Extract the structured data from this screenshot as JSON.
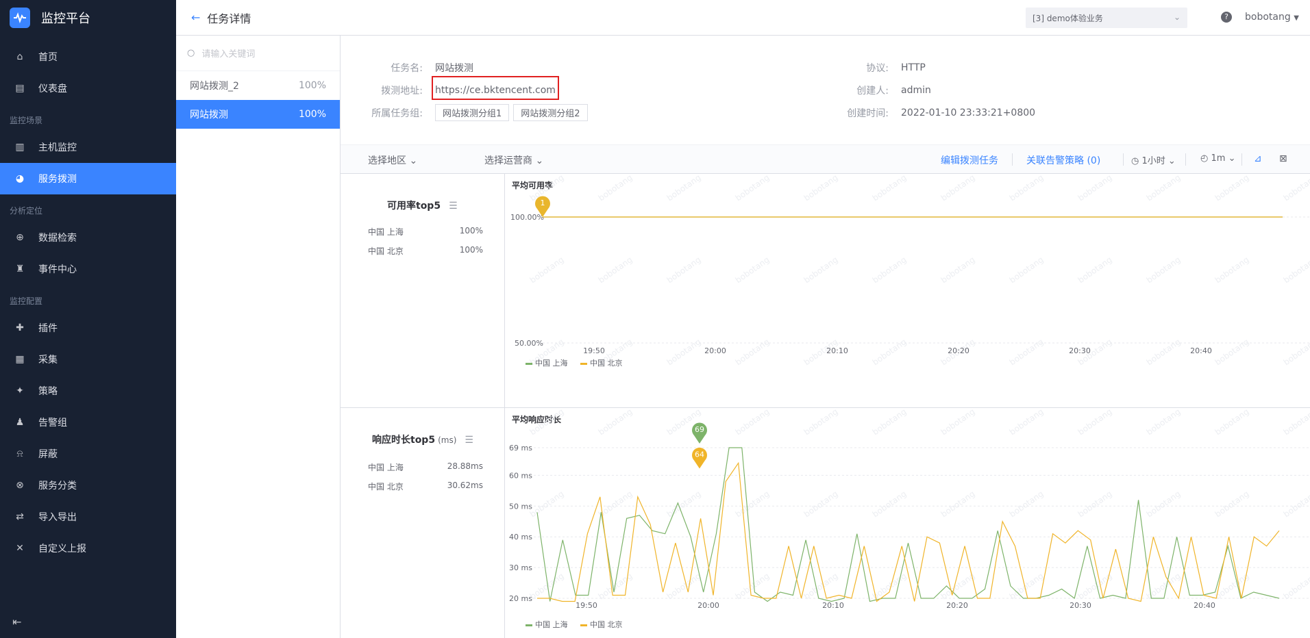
{
  "app": {
    "name": "监控平台"
  },
  "nav": {
    "items": [
      {
        "label": "首页",
        "icon": "home-icon"
      },
      {
        "label": "仪表盘",
        "icon": "dashboard-icon"
      }
    ],
    "group1": "监控场景",
    "group1_items": [
      {
        "label": "主机监控",
        "icon": "host-icon"
      },
      {
        "label": "服务拨测",
        "icon": "probe-icon",
        "active": true
      }
    ],
    "group2": "分析定位",
    "group2_items": [
      {
        "label": "数据检索",
        "icon": "search-data-icon"
      },
      {
        "label": "事件中心",
        "icon": "event-icon"
      }
    ],
    "group3": "监控配置",
    "group3_items": [
      {
        "label": "插件",
        "icon": "plugin-icon"
      },
      {
        "label": "采集",
        "icon": "collect-icon"
      },
      {
        "label": "策略",
        "icon": "strategy-icon"
      },
      {
        "label": "告警组",
        "icon": "alarm-group-icon"
      },
      {
        "label": "屏蔽",
        "icon": "shield-icon"
      },
      {
        "label": "服务分类",
        "icon": "category-icon"
      },
      {
        "label": "导入导出",
        "icon": "import-export-icon"
      },
      {
        "label": "自定义上报",
        "icon": "custom-report-icon"
      }
    ]
  },
  "header": {
    "title": "任务详情",
    "business": "[3] demo体验业务",
    "help": "?",
    "user": "bobotang"
  },
  "task_list": {
    "search_placeholder": "请输入关键词",
    "tasks": [
      {
        "name": "网站拨测_2",
        "rate": "100%"
      },
      {
        "name": "网站拨测",
        "rate": "100%",
        "active": true
      }
    ]
  },
  "info": {
    "task_name_label": "任务名:",
    "task_name": "网站拨测",
    "url_label": "拨测地址:",
    "url": "https://ce.bktencent.com",
    "group_label": "所属任务组:",
    "groups": [
      "网站拨测分组1",
      "网站拨测分组2"
    ],
    "protocol_label": "协议:",
    "protocol": "HTTP",
    "creator_label": "创建人:",
    "creator": "admin",
    "created_label": "创建时间:",
    "created": "2022-01-10 23:33:21+0800"
  },
  "toolbar": {
    "region": "选择地区",
    "isp": "选择运营商",
    "edit": "编辑拨测任务",
    "alarm": "关联告警策略",
    "alarm_count": "(0)",
    "time_range": "1小时",
    "interval": "1m"
  },
  "availability": {
    "top5_title": "可用率top5",
    "rows": [
      {
        "name": "中国 上海",
        "value": "100%"
      },
      {
        "name": "中国 北京",
        "value": "100%"
      }
    ],
    "chart_title": "平均可用率"
  },
  "response": {
    "top5_title": "响应时长top5",
    "unit": "(ms)",
    "rows": [
      {
        "name": "中国 上海",
        "value": "28.88ms"
      },
      {
        "name": "中国 北京",
        "value": "30.62ms"
      }
    ],
    "chart_title": "平均响应时长"
  },
  "watermark": "bobotang",
  "colors": {
    "accent": "#3a84ff",
    "green": "#7db369",
    "yellow": "#f0b429",
    "highlight": "#e02020"
  },
  "chart_data": [
    {
      "type": "line",
      "title": "平均可用率",
      "ytick_labels": [
        "100.00%",
        "50.00%"
      ],
      "xtick_labels": [
        "19:50",
        "20:00",
        "20:10",
        "20:20",
        "20:30",
        "20:40"
      ],
      "series": [
        {
          "name": "中国 上海",
          "color": "#7db369",
          "values": [
            100
          ]
        },
        {
          "name": "中国 北京",
          "color": "#f0b429",
          "values": [
            100
          ]
        }
      ],
      "marker": {
        "label": "1"
      },
      "legend": "bottom-left"
    },
    {
      "type": "line",
      "title": "平均响应时长",
      "ylim": [
        20,
        69
      ],
      "ytick_labels": [
        "69 ms",
        "60 ms",
        "50 ms",
        "40 ms",
        "30 ms",
        "20 ms"
      ],
      "yticks": [
        69,
        60,
        50,
        40,
        30,
        20
      ],
      "xtick_labels": [
        "19:50",
        "20:00",
        "20:10",
        "20:20",
        "20:30",
        "20:40"
      ],
      "series": [
        {
          "name": "中国 上海",
          "color": "#7db369",
          "values": [
            48,
            19,
            39,
            21,
            21,
            48,
            22,
            46,
            47,
            42,
            41,
            51,
            40,
            22,
            41,
            69,
            69,
            22,
            19,
            22,
            21,
            39,
            20,
            19,
            20,
            41,
            19,
            20,
            20,
            38,
            20,
            20,
            24,
            20,
            20,
            23,
            42,
            24,
            20,
            20,
            21,
            23,
            20,
            37,
            20,
            21,
            20,
            52,
            20,
            20,
            40,
            21,
            21,
            22,
            37,
            20,
            22,
            21,
            20
          ]
        },
        {
          "name": "中国 北京",
          "color": "#f0b429",
          "values": [
            20,
            20,
            19,
            19,
            41,
            53,
            21,
            21,
            53,
            44,
            22,
            38,
            22,
            46,
            21,
            58,
            64,
            21,
            20,
            20,
            37,
            20,
            37,
            20,
            21,
            20,
            37,
            19,
            22,
            37,
            19,
            40,
            38,
            21,
            37,
            20,
            20,
            45,
            37,
            20,
            20,
            41,
            38,
            42,
            39,
            20,
            36,
            20,
            19,
            40,
            27,
            20,
            40,
            21,
            20,
            40,
            20,
            40,
            37,
            42
          ]
        }
      ],
      "markers": [
        {
          "label": "69"
        },
        {
          "label": "64"
        }
      ],
      "legend": "bottom-left"
    }
  ]
}
